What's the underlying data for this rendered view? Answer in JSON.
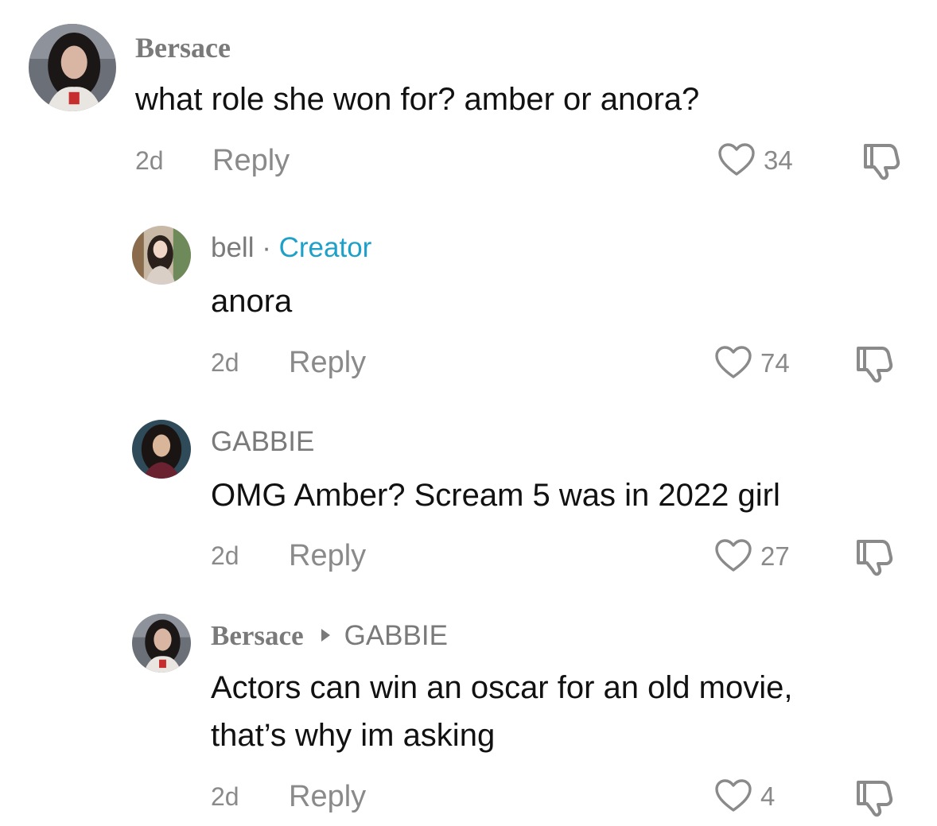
{
  "comments": [
    {
      "username": "Bersace",
      "text": "what role she won for? amber or anora?",
      "time": "2d",
      "reply_label": "Reply",
      "likes": "34",
      "avatar_icon": "avatar-photo"
    },
    {
      "username": "bell",
      "separator": "·",
      "badge": "Creator",
      "text": "anora",
      "time": "2d",
      "reply_label": "Reply",
      "likes": "74",
      "avatar_icon": "avatar-photo"
    },
    {
      "username": "GABBIE",
      "text": "OMG Amber? Scream 5 was in 2022 girl",
      "time": "2d",
      "reply_label": "Reply",
      "likes": "27",
      "avatar_icon": "avatar-photo"
    },
    {
      "username": "Bersace",
      "reply_to": "GABBIE",
      "text_line1": "Actors can win an oscar for an old movie,",
      "text_line2": "that’s why im asking",
      "time": "2d",
      "reply_label": "Reply",
      "likes": "4",
      "avatar_icon": "avatar-photo"
    }
  ],
  "colors": {
    "muted": "#8a8a8a",
    "creator_badge": "#1fa0c9",
    "text": "#111111"
  }
}
